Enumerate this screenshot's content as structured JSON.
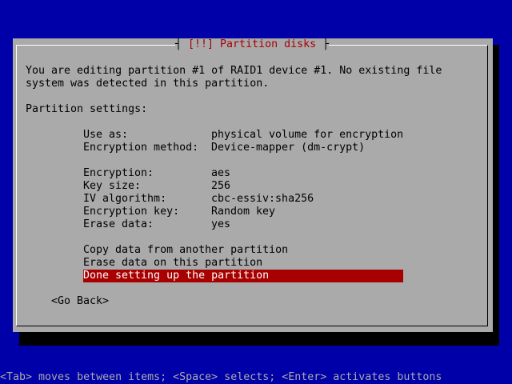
{
  "dialog": {
    "title": "[!!] Partition disks",
    "intro_line1": "You are editing partition #1 of RAID1 device #1. No existing file",
    "intro_line2": "system was detected in this partition.",
    "settings_heading": "Partition settings:",
    "settings": [
      {
        "label": "Use as:",
        "value": "physical volume for encryption"
      },
      {
        "label": "Encryption method:",
        "value": "Device-mapper (dm-crypt)"
      },
      {
        "label": "Encryption:",
        "value": "aes"
      },
      {
        "label": "Key size:",
        "value": "256"
      },
      {
        "label": "IV algorithm:",
        "value": "cbc-essiv:sha256"
      },
      {
        "label": "Encryption key:",
        "value": "Random key"
      },
      {
        "label": "Erase data:",
        "value": "yes"
      }
    ],
    "actions": [
      "Copy data from another partition",
      "Erase data on this partition",
      "Done setting up the partition"
    ],
    "go_back": "<Go Back>"
  },
  "status_bar": "<Tab> moves between items; <Space> selects; <Enter> activates buttons",
  "colors": {
    "background": "#0000a8",
    "dialog": "#aaaaaa",
    "title": "#a80000",
    "selection": "#a80000"
  }
}
